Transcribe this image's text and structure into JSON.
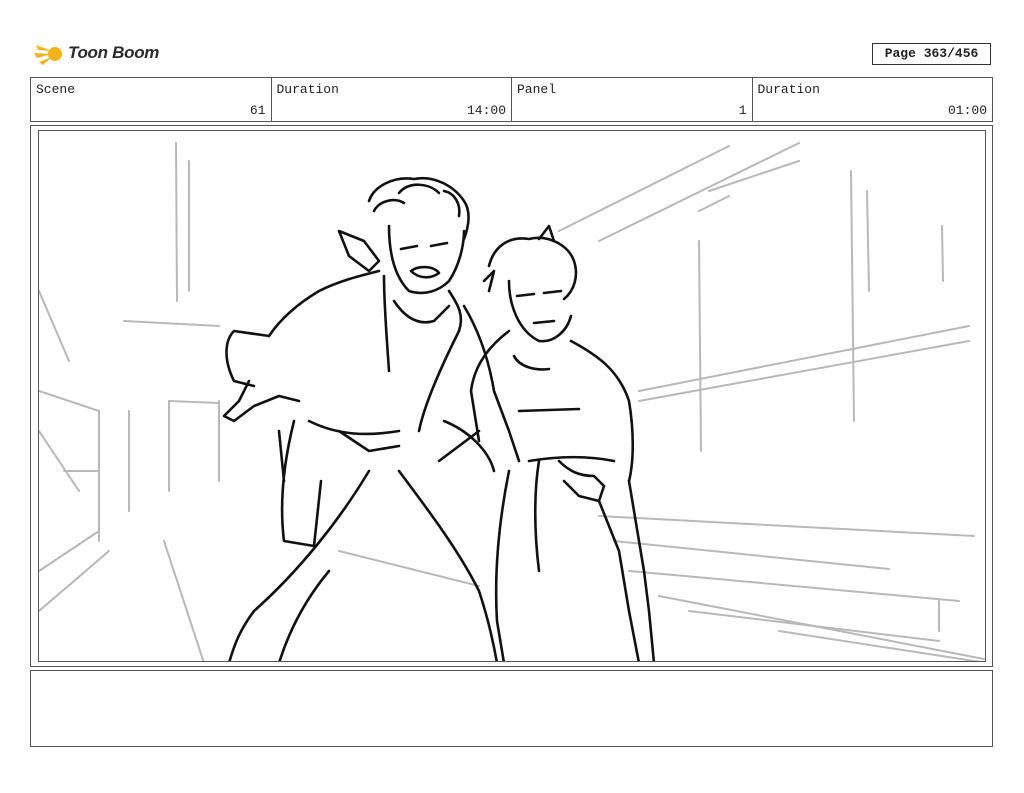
{
  "brand": {
    "name": "Toon Boom",
    "accent": "#f2b418"
  },
  "page": {
    "label": "Page 363/456"
  },
  "header": {
    "scene_label": "Scene",
    "scene_value": "61",
    "duration_label": "Duration",
    "duration_value": "14:00",
    "panel_label": "Panel",
    "panel_value": "1",
    "panel_duration_label": "Duration",
    "panel_duration_value": "01:00"
  },
  "notes": {
    "text": ""
  }
}
